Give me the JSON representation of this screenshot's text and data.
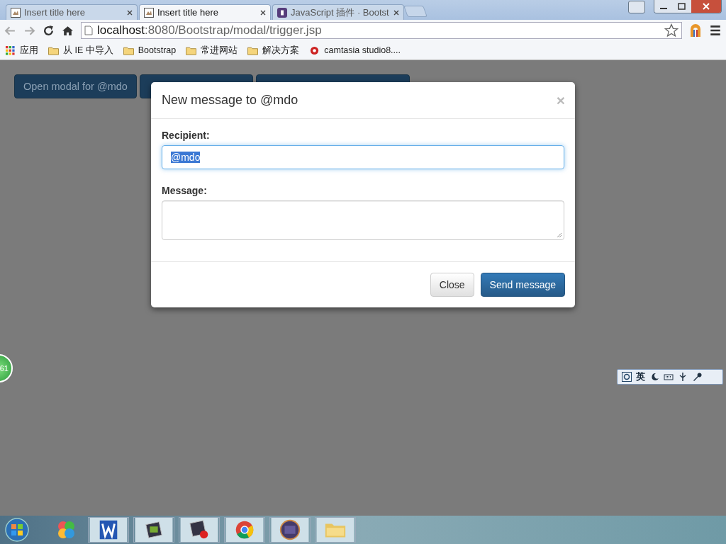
{
  "browser": {
    "tabs": [
      {
        "title": "Insert title here",
        "selected": false,
        "kind": "page"
      },
      {
        "title": "Insert title here",
        "selected": true,
        "kind": "page"
      },
      {
        "title": "JavaScript 插件 · Bootst",
        "selected": false,
        "kind": "bootstrap"
      }
    ],
    "url": {
      "host": "localhost",
      "rest": ":8080/Bootstrap/modal/trigger.jsp"
    },
    "bookmarks": [
      {
        "label": "应用",
        "kind": "apps"
      },
      {
        "label": "从 IE 中导入",
        "kind": "folder"
      },
      {
        "label": "Bootstrap",
        "kind": "folder"
      },
      {
        "label": "常进网站",
        "kind": "folder"
      },
      {
        "label": "解决方案",
        "kind": "folder"
      },
      {
        "label": "camtasia studio8....",
        "kind": "site"
      }
    ]
  },
  "page": {
    "trigger_button": "Open modal for @mdo"
  },
  "modal": {
    "title": "New message to @mdo",
    "close": "×",
    "fields": [
      {
        "label": "Recipient:",
        "kind": "input",
        "value": "@mdo",
        "text_selected": true
      },
      {
        "label": "Message:",
        "kind": "textarea"
      }
    ],
    "buttons": [
      {
        "label": "Close",
        "kind": "default"
      },
      {
        "label": "Send message",
        "kind": "primary"
      }
    ]
  },
  "side_badge": "61",
  "ime_toolbar": {
    "language": "英"
  }
}
